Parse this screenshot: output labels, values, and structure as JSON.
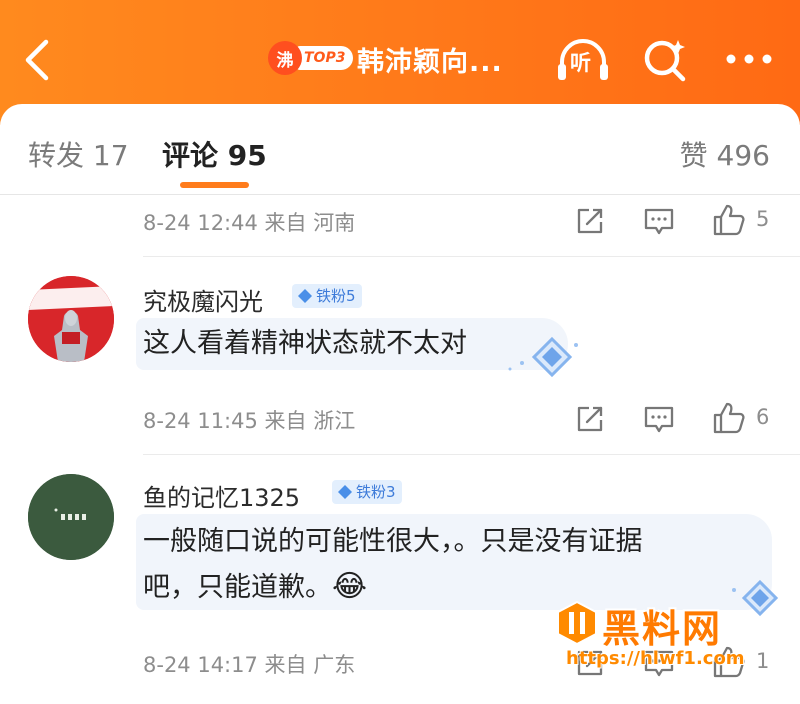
{
  "header": {
    "title": "韩沛颖向...",
    "hot_badge_char": "沸",
    "hot_badge_label": "TOP3",
    "listen_label": "听",
    "accent_color": "#ff7a1a"
  },
  "tabs": {
    "repost": "转发 17",
    "comment": "评论 95",
    "like": "赞 496"
  },
  "comments": [
    {
      "meta": "8-24 12:44 来自 河南",
      "like_count": "5"
    },
    {
      "username": "究极魔闪光",
      "fan_badge": "铁粉5",
      "text": "这人看着精神状态就不太对",
      "meta": "8-24 11:45 来自 浙江",
      "like_count": "6",
      "avatar_text": "ウルトラマン"
    },
    {
      "username": "鱼的记忆1325",
      "fan_badge": "铁粉3",
      "text_line1": "一般随口说的可能性很大，。只是没有证据",
      "text_line2": "吧，只能道歉。",
      "emoji": "😂",
      "meta": "8-24 14:17 来自 广东",
      "like_count": "1"
    }
  ],
  "watermark": {
    "title": "黑料网",
    "url": "https://hlwf1.com"
  }
}
